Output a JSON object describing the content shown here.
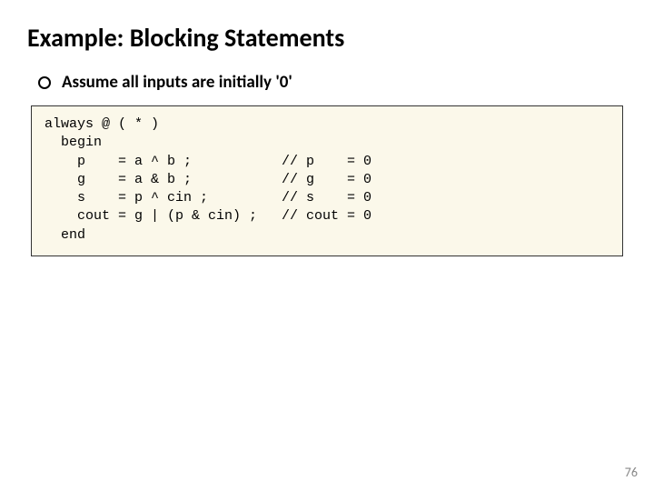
{
  "title": "Example: Blocking Statements",
  "bullet": "Assume all inputs are initially '0'",
  "code": "always @ ( * )\n  begin\n    p    = a ^ b ;           // p    = 0\n    g    = a & b ;           // g    = 0\n    s    = p ^ cin ;         // s    = 0\n    cout = g | (p & cin) ;   // cout = 0\n  end",
  "page_number": "76"
}
